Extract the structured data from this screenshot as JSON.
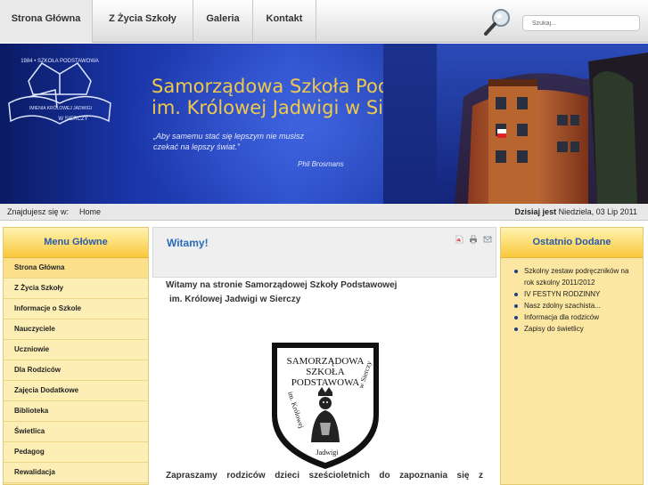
{
  "nav": {
    "items": [
      {
        "label": "Strona Główna"
      },
      {
        "label": "Z Życia Szkoły"
      },
      {
        "label": "Galeria"
      },
      {
        "label": "Kontakt"
      }
    ],
    "search_placeholder": "Szukaj..."
  },
  "banner": {
    "title_line1": "Samorządowa Szkoła Podstawowa",
    "title_line2": "im. Królowej Jadwigi w Sierczy",
    "quote_line1": "„Aby samemu stać się lepszym nie musisz",
    "quote_line2": "czekać na lepszy świat.”",
    "author": "Phil Brosmans",
    "logo_text": "1984 • SZKOŁA PODSTAWOWA • IMIENIA KRÓLOWEJ JADWIGI • W SIERCZY"
  },
  "breadcrumb": {
    "label": "Znajdujesz się w:",
    "home": "Home",
    "today_label": "Dzisiaj jest",
    "today_value": "Niedziela, 03 Lip 2011"
  },
  "left_menu": {
    "title": "Menu Główne",
    "items": [
      {
        "label": "Strona Główna"
      },
      {
        "label": "Z Życia Szkoły"
      },
      {
        "label": "Informacje o Szkole"
      },
      {
        "label": "Nauczyciele"
      },
      {
        "label": "Uczniowie"
      },
      {
        "label": "Dla Rodziców"
      },
      {
        "label": "Zajęcia Dodatkowe"
      },
      {
        "label": "Biblioteka"
      },
      {
        "label": "Świetlica"
      },
      {
        "label": "Pedagog"
      },
      {
        "label": "Rewalidacja"
      }
    ]
  },
  "article": {
    "title": "Witamy!",
    "intro_line1": "Witamy na stronie Samorządowej Szkoły Podstawowej",
    "intro_line2": "im. Królowej Jadwigi w Sierczy",
    "crest_text": "SAMORZĄDOWA SZKOŁA PODSTAWOWA im. Królowej Jadwigi w Sierczy",
    "lead": "Zapraszamy rodziców dzieci sześcioletnich do zapoznania się z"
  },
  "recent": {
    "title": "Ostatnio Dodane",
    "items": [
      {
        "label": "Szkolny zestaw podręczników na rok szkolny 2011/2012"
      },
      {
        "label": "IV FESTYN RODZINNY"
      },
      {
        "label": "Nasz zdolny szachista..."
      },
      {
        "label": "Informacja dla rodziców"
      },
      {
        "label": "Zapisy do świetlicy"
      }
    ]
  },
  "colors": {
    "accent_blue": "#2a6ab8",
    "banner_title": "#f0c94a",
    "column_bg": "#fbe7a1"
  },
  "icons": [
    "search-icon",
    "pdf-icon",
    "print-icon",
    "email-icon"
  ]
}
